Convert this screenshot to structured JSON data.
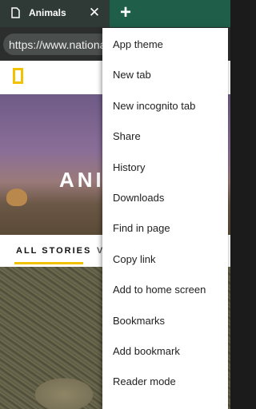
{
  "tab": {
    "title": "Animals",
    "close_icon": "close-icon",
    "page_icon": "document-icon"
  },
  "new_tab_icon": "plus-icon",
  "address_bar": {
    "url": "https://www.nationalgeographic.com"
  },
  "page": {
    "hero_title": "ANI",
    "nav_all_stories": "ALL STORIES",
    "nav_next": "V"
  },
  "menu": {
    "items": [
      "App theme",
      "New tab",
      "New incognito tab",
      "Share",
      "History",
      "Downloads",
      "Find in page",
      "Copy link",
      "Add to home screen",
      "Bookmarks",
      "Add bookmark",
      "Reader mode"
    ]
  },
  "colors": {
    "tabbar": "#1f5e49",
    "accent": "#f2c200"
  }
}
